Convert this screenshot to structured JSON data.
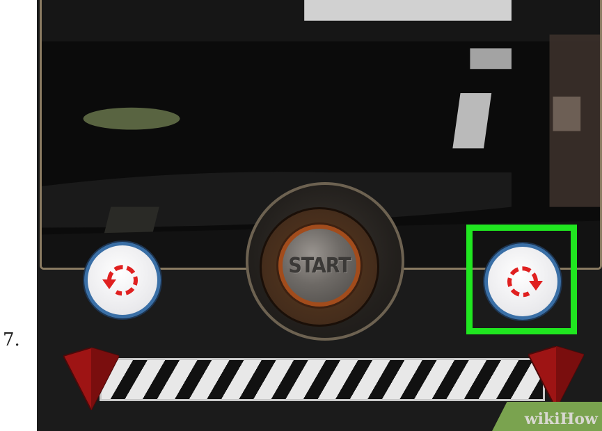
{
  "step": {
    "number": "7."
  },
  "camera": {
    "start_label": "START"
  },
  "controls": {
    "rotate_left_icon": "rotate-counterclockwise-icon",
    "rotate_right_icon": "rotate-clockwise-icon",
    "highlighted_control": "rotate-right-button"
  },
  "colors": {
    "highlight": "#20e620",
    "rotate_arrow": "#e02020",
    "button_ring": "#3a6fa6",
    "start_ring": "#a24c1c",
    "handle": "#9e1414"
  },
  "watermark": {
    "text": "wikiHow"
  }
}
